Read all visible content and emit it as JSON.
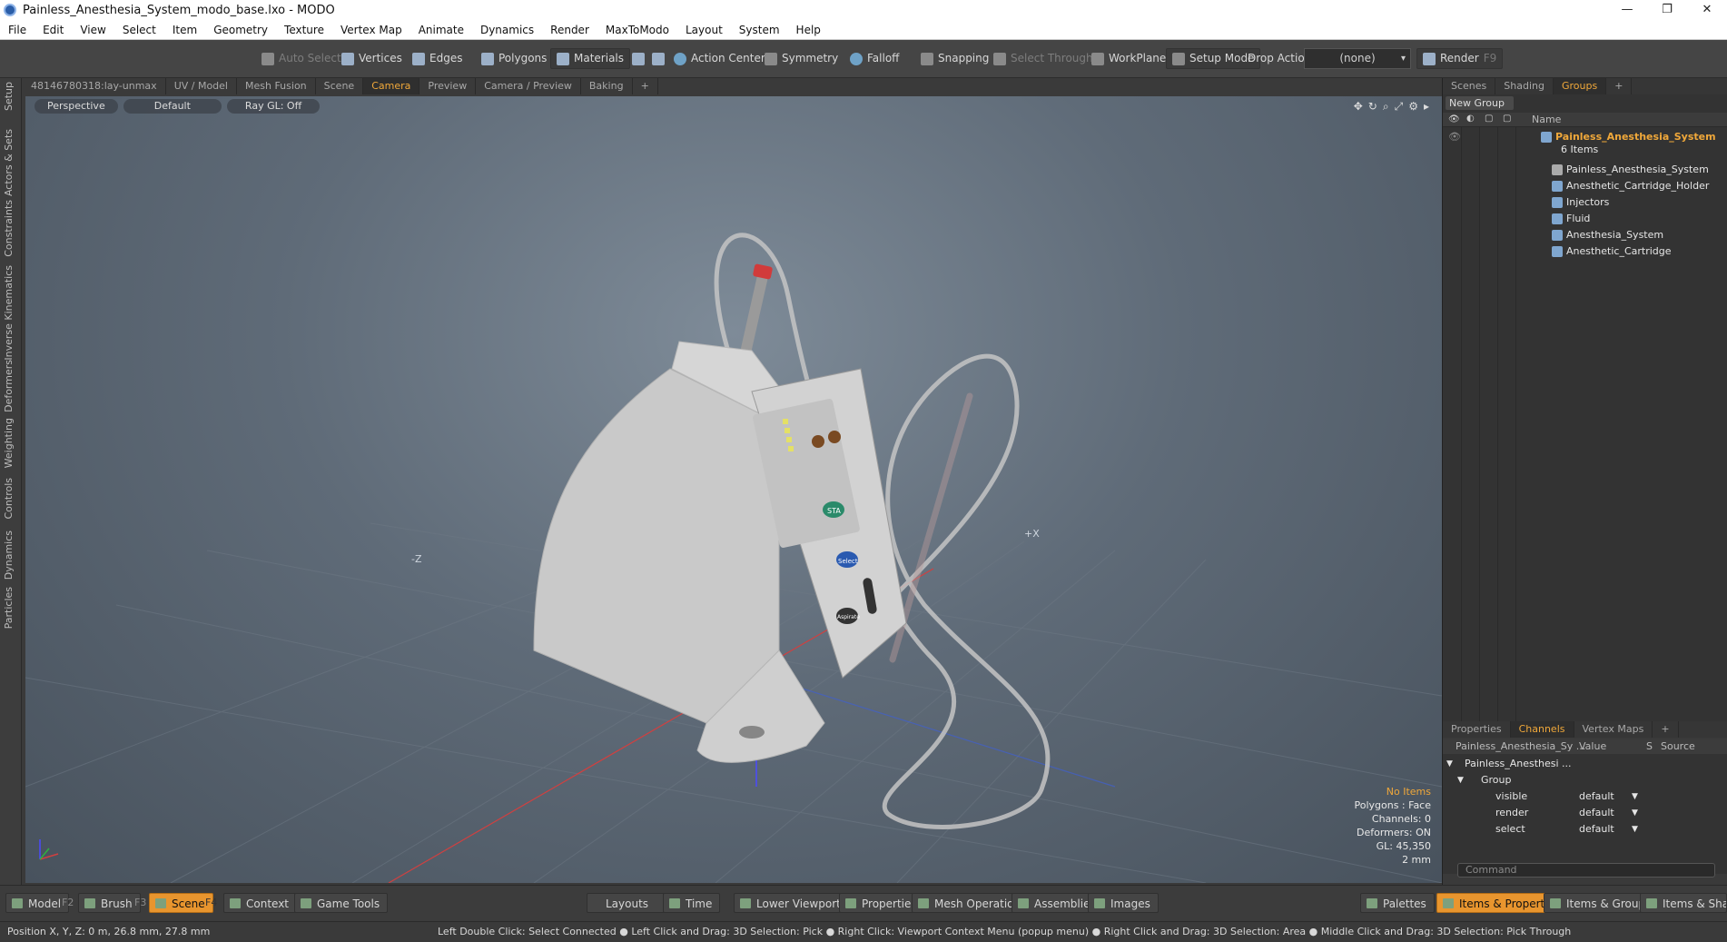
{
  "window": {
    "title": "Painless_Anesthesia_System_modo_base.lxo - MODO",
    "minimize": "—",
    "restore": "❐",
    "close": "✕"
  },
  "menu": [
    "File",
    "Edit",
    "View",
    "Select",
    "Item",
    "Geometry",
    "Texture",
    "Vertex Map",
    "Animate",
    "Dynamics",
    "Render",
    "MaxToModo",
    "Layout",
    "System",
    "Help"
  ],
  "toolbar": {
    "auto_select": "Auto Select",
    "vertices": "Vertices",
    "edges": "Edges",
    "polygons": "Polygons",
    "materials": "Materials",
    "action_center": "Action Center",
    "symmetry": "Symmetry",
    "falloff": "Falloff",
    "snapping": "Snapping",
    "select_through": "Select Through",
    "workplane": "WorkPlane",
    "setup_mode": "Setup Mode",
    "drop_action": "Drop Action",
    "drop_value": "(none)",
    "render": "Render",
    "render_key": "F9"
  },
  "left_tabs": [
    "Setup",
    "Actors & Sets",
    "Constraints",
    "Inverse Kinematics",
    "Deformers",
    "Weighting",
    "Controls",
    "Dynamics",
    "Particles"
  ],
  "viewport_tabs": [
    "48146780318:lay-unmax",
    "UV / Model",
    "Mesh Fusion",
    "Scene",
    "Camera",
    "Preview",
    "Camera / Preview",
    "Baking",
    "+"
  ],
  "viewport": {
    "view_mode": "Perspective",
    "shading": "Default",
    "raygl": "Ray GL: Off",
    "axis_minus_z": "-Z",
    "axis_plus_x": "+X",
    "device": {
      "btn_sta": "STA",
      "btn_select": "Select",
      "btn_aspirate": "Aspirate"
    },
    "info": {
      "items": "No Items",
      "polygons": "Polygons : Face",
      "channels": "Channels: 0",
      "deformers": "Deformers: ON",
      "gl": "GL: 45,350",
      "scale": "2 mm"
    }
  },
  "right_panel": {
    "tabs": [
      "Scenes",
      "Shading",
      "Groups",
      "+"
    ],
    "new_group": "New Group",
    "name_col": "Name",
    "root": {
      "label": "Painless_Anesthesia_System",
      "count": "6 Items"
    },
    "items": [
      "Painless_Anesthesia_System",
      "Anesthetic_Cartridge_Holder",
      "Injectors",
      "Fluid",
      "Anesthesia_System",
      "Anesthetic_Cartridge"
    ],
    "bottom_tabs": [
      "Properties",
      "Channels",
      "Vertex Maps",
      "+"
    ],
    "channels": {
      "col_name": "Painless_Anesthesia_Sy ...",
      "col_value": "Value",
      "col_s": "S",
      "col_source": "Source",
      "root": "Painless_Anesthesi ...",
      "group": "Group",
      "rows": [
        {
          "name": "visible",
          "value": "default"
        },
        {
          "name": "render",
          "value": "default"
        },
        {
          "name": "select",
          "value": "default"
        }
      ]
    },
    "command_placeholder": "Command"
  },
  "bottom_bar": {
    "model": "Model",
    "model_key": "F2",
    "brush": "Brush",
    "brush_key": "F3",
    "scene": "Scene",
    "scene_key": "F4",
    "context": "Context",
    "game_tools": "Game Tools",
    "layouts": "Layouts",
    "time": "Time",
    "lower_viewports": "Lower Viewports",
    "properties": "Properties",
    "mesh_operations": "Mesh Operations",
    "assemblies": "Assemblies",
    "images": "Images",
    "palettes": "Palettes",
    "items_properties": "Items & Properties",
    "items_groups": "Items & Groups",
    "items_shading": "Items & Shadin"
  },
  "status": {
    "position": "Position X, Y, Z:   0 m, 26.8 mm, 27.8 mm",
    "hints": "Left Double Click: Select Connected ● Left Click and Drag: 3D Selection: Pick ● Right Click: Viewport Context Menu (popup menu) ● Right Click and Drag: 3D Selection: Area ● Middle Click and Drag: 3D Selection: Pick Through"
  },
  "colors": {
    "accent": "#f0a83a",
    "active_button": "#e8952e"
  }
}
